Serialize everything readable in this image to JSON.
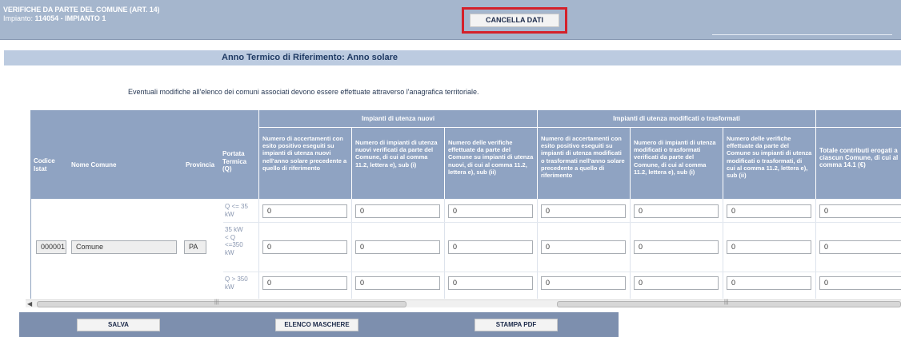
{
  "header": {
    "title": "VERIFICHE DA PARTE DEL COMUNE (ART. 14)",
    "impianto_label": "Impianto:",
    "impianto_value": "114054 - IMPIANTO 1",
    "cancel_button": "CANCELLA DATI"
  },
  "year_band": "Anno Termico di Riferimento: Anno solare",
  "notice": "Eventuali modifiche all'elenco dei comuni associati devono essere effettuate attraverso l'anagrafica territoriale.",
  "table": {
    "groups": {
      "nuovi": "Impianti di utenza nuovi",
      "modificati": "Impianti di utenza modificati o trasformati"
    },
    "headers": {
      "codice": "Codice Istat",
      "nome": "Nome Comune",
      "provincia": "Provincia",
      "portata": "Portata Termica (Q)",
      "c1": "Numero di accertamenti con esito positivo eseguiti su impianti di utenza nuovi nell'anno solare precedente a quello di riferimento",
      "c2": "Numero di impianti di utenza nuovi verificati da parte del Comune, di cui al comma 11.2, lettera e), sub (i)",
      "c3": "Numero delle verifiche effettuate da parte del Comune su impianti di utenza nuovi, di cui al comma 11.2, lettera e), sub (ii)",
      "c4": "Numero di accertamenti con esito positivo eseguiti su impianti di utenza modificati o trasformati nell'anno solare precedente a quello di riferimento",
      "c5": "Numero di impianti di utenza modificati o trasformati verificati da parte del Comune, di cui al comma 11.2, lettera e), sub (i)",
      "c6": "Numero delle verifiche effettuate da parte del Comune su impianti di utenza modificati o trasformati, di cui al comma 11.2, lettera e), sub (ii)",
      "c7": "Totale contributi erogati a ciascun Comune, di cui al comma 14.1 (€)"
    },
    "row": {
      "codice": "000001",
      "nome": "Comune",
      "provincia": "PA"
    },
    "portata": [
      "Q <= 35 kW",
      "35 kW < Q <=350 kW",
      "Q > 350 kW"
    ],
    "values": [
      [
        "0",
        "0",
        "0",
        "0",
        "0",
        "0",
        "0"
      ],
      [
        "0",
        "0",
        "0",
        "0",
        "0",
        "0",
        "0"
      ],
      [
        "0",
        "0",
        "0",
        "0",
        "0",
        "0",
        "0"
      ]
    ]
  },
  "buttons": {
    "salva": "SALVA",
    "elenco": "ELENCO MASCHERE",
    "stampa": "STAMPA PDF"
  }
}
